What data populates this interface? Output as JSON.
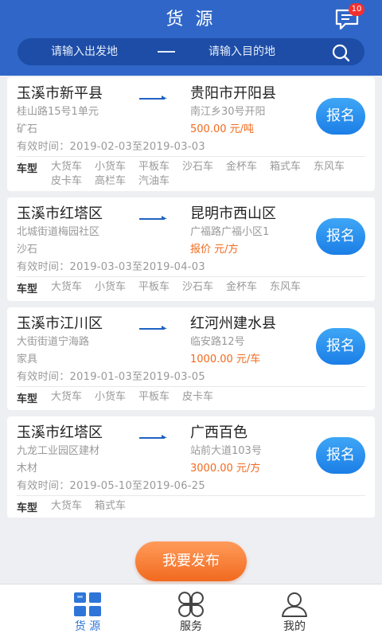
{
  "header": {
    "title": "货 源",
    "message_badge": "10"
  },
  "search": {
    "from_placeholder": "请输入出发地",
    "separator": "—",
    "to_placeholder": "请输入目的地"
  },
  "labels": {
    "vehicle_type": "车型",
    "apply": "报名"
  },
  "cards": [
    {
      "from_city": "玉溪市新平县",
      "from_address": "桂山路15号1单元",
      "to_city": "贵阳市开阳县",
      "to_address": "南江乡30号开阳",
      "goods": "矿石",
      "price": "500.00 元/吨",
      "validity": "有效时间：2019-02-03至2019-03-03",
      "vehicle_types": [
        "大货车",
        "小货车",
        "平板车",
        "沙石车",
        "金杯车",
        "箱式车",
        "东风车",
        "皮卡车",
        "高栏车",
        "汽油车"
      ]
    },
    {
      "from_city": "玉溪市红塔区",
      "from_address": "北城街道梅园社区",
      "to_city": "昆明市西山区",
      "to_address": "广福路广福小区1",
      "goods": "沙石",
      "price": "报价 元/方",
      "validity": "有效时间：2019-03-03至2019-04-03",
      "vehicle_types": [
        "大货车",
        "小货车",
        "平板车",
        "沙石车",
        "金杯车",
        "东风车"
      ]
    },
    {
      "from_city": "玉溪市江川区",
      "from_address": "大街街道宁海路",
      "to_city": "红河州建水县",
      "to_address": "临安路12号",
      "goods": "家具",
      "price": "1000.00 元/车",
      "validity": "有效时间：2019-01-03至2019-03-05",
      "vehicle_types": [
        "大货车",
        "小货车",
        "平板车",
        "皮卡车"
      ]
    },
    {
      "from_city": "玉溪市红塔区",
      "from_address": "九龙工业园区建材",
      "to_city": "广西百色",
      "to_address": "站前大道103号",
      "goods": "木材",
      "price": "3000.00 元/方",
      "validity": "有效时间：2019-05-10至2019-06-25",
      "vehicle_types": [
        "大货车",
        "箱式车"
      ]
    }
  ],
  "publish_button": "我要发布",
  "tabbar": {
    "items": [
      {
        "label": "货 源",
        "icon": "grid-icon",
        "active": true
      },
      {
        "label": "服务",
        "icon": "clover-icon",
        "active": false
      },
      {
        "label": "我的",
        "icon": "user-icon",
        "active": false
      }
    ]
  },
  "colors": {
    "primary": "#2f66c8",
    "search_bg": "#1d4da6",
    "price": "#f26a1d",
    "apply_button": "#2a8cee",
    "publish_button": "#f47a2e",
    "tab_active": "#2e75d8"
  }
}
